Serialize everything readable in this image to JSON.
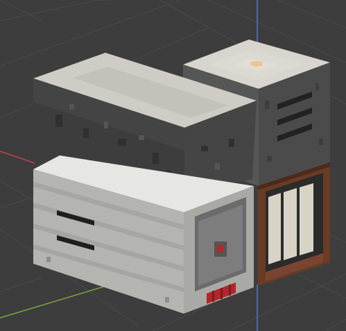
{
  "viewport": {
    "background": "#3d3d3d",
    "grid_color": "#4a4a4a",
    "axis_x_color": "#c0454f",
    "axis_y_color": "#7fa83a",
    "axis_z_color": "#4a7bc8"
  },
  "scene": {
    "objects": [
      {
        "name": "dark-lidded-box",
        "top_color": "#cfccc6",
        "side_color": "#3d3d3d"
      },
      {
        "name": "vented-cabinet",
        "top_color": "#d8d5cf",
        "side_color": "#4b4b4b"
      },
      {
        "name": "white-drawer-unit",
        "top_color": "#e6e6e3",
        "side_color": "#b4b5b1"
      },
      {
        "name": "drawer-front-panel",
        "indicator_color": "#b3262a"
      },
      {
        "name": "wooden-glass-cabinet",
        "frame_color": "#6a3b25",
        "panel_color": "#d7d4c6"
      }
    ]
  }
}
